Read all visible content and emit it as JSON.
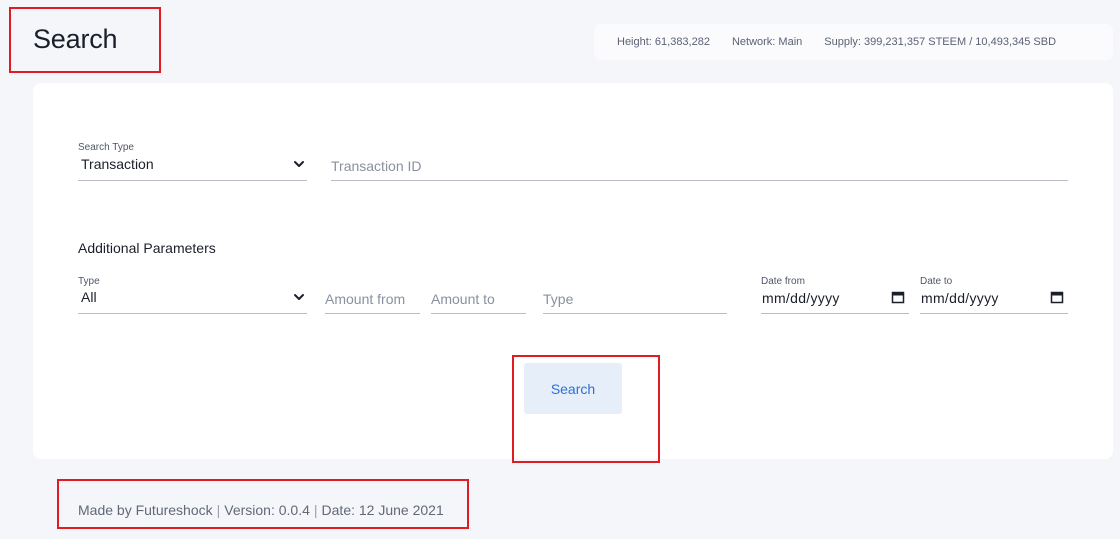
{
  "page": {
    "title": "Search"
  },
  "stats": {
    "height": "Height: 61,383,282",
    "network": "Network: Main",
    "supply": "Supply: 399,231,357 STEEM / 10,493,345 SBD"
  },
  "search_form": {
    "search_type_label": "Search Type",
    "search_type_value": "Transaction",
    "transaction_id_placeholder": "Transaction ID",
    "additional_title": "Additional Parameters",
    "type_label": "Type",
    "type_value": "All",
    "amount_from_placeholder": "Amount from",
    "amount_to_placeholder": "Amount to",
    "type_text_placeholder": "Type",
    "date_from_label": "Date from",
    "date_from_value": "mm/dd/yyyy",
    "date_to_label": "Date to",
    "date_to_value": "mm/dd/yyyy",
    "submit_label": "Search"
  },
  "footer": {
    "made_by": "Made by Futureshock",
    "version": "Version: 0.0.4",
    "date": "Date: 12 June 2021"
  },
  "colors": {
    "background": "#f5f6f9",
    "card": "#ffffff",
    "button_bg": "#e5eef9",
    "button_text": "#2f6fd6",
    "highlight": "#e01c22"
  },
  "icons": [
    "chevron-down-icon",
    "calendar-icon"
  ]
}
